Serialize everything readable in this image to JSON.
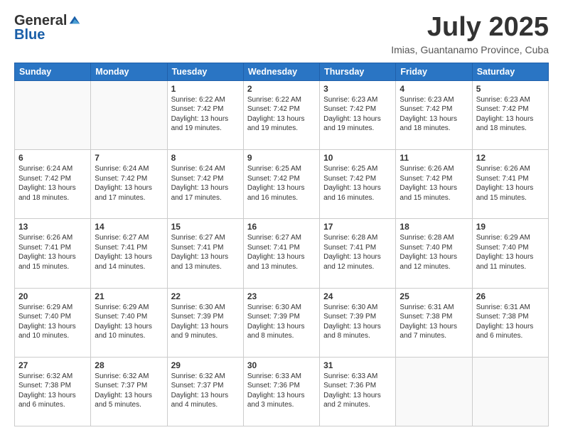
{
  "logo": {
    "general": "General",
    "blue": "Blue"
  },
  "header": {
    "month": "July 2025",
    "location": "Imias, Guantanamo Province, Cuba"
  },
  "days": [
    "Sunday",
    "Monday",
    "Tuesday",
    "Wednesday",
    "Thursday",
    "Friday",
    "Saturday"
  ],
  "weeks": [
    [
      {
        "day": "",
        "info": ""
      },
      {
        "day": "",
        "info": ""
      },
      {
        "day": "1",
        "info": "Sunrise: 6:22 AM\nSunset: 7:42 PM\nDaylight: 13 hours\nand 19 minutes."
      },
      {
        "day": "2",
        "info": "Sunrise: 6:22 AM\nSunset: 7:42 PM\nDaylight: 13 hours\nand 19 minutes."
      },
      {
        "day": "3",
        "info": "Sunrise: 6:23 AM\nSunset: 7:42 PM\nDaylight: 13 hours\nand 19 minutes."
      },
      {
        "day": "4",
        "info": "Sunrise: 6:23 AM\nSunset: 7:42 PM\nDaylight: 13 hours\nand 18 minutes."
      },
      {
        "day": "5",
        "info": "Sunrise: 6:23 AM\nSunset: 7:42 PM\nDaylight: 13 hours\nand 18 minutes."
      }
    ],
    [
      {
        "day": "6",
        "info": "Sunrise: 6:24 AM\nSunset: 7:42 PM\nDaylight: 13 hours\nand 18 minutes."
      },
      {
        "day": "7",
        "info": "Sunrise: 6:24 AM\nSunset: 7:42 PM\nDaylight: 13 hours\nand 17 minutes."
      },
      {
        "day": "8",
        "info": "Sunrise: 6:24 AM\nSunset: 7:42 PM\nDaylight: 13 hours\nand 17 minutes."
      },
      {
        "day": "9",
        "info": "Sunrise: 6:25 AM\nSunset: 7:42 PM\nDaylight: 13 hours\nand 16 minutes."
      },
      {
        "day": "10",
        "info": "Sunrise: 6:25 AM\nSunset: 7:42 PM\nDaylight: 13 hours\nand 16 minutes."
      },
      {
        "day": "11",
        "info": "Sunrise: 6:26 AM\nSunset: 7:42 PM\nDaylight: 13 hours\nand 15 minutes."
      },
      {
        "day": "12",
        "info": "Sunrise: 6:26 AM\nSunset: 7:41 PM\nDaylight: 13 hours\nand 15 minutes."
      }
    ],
    [
      {
        "day": "13",
        "info": "Sunrise: 6:26 AM\nSunset: 7:41 PM\nDaylight: 13 hours\nand 15 minutes."
      },
      {
        "day": "14",
        "info": "Sunrise: 6:27 AM\nSunset: 7:41 PM\nDaylight: 13 hours\nand 14 minutes."
      },
      {
        "day": "15",
        "info": "Sunrise: 6:27 AM\nSunset: 7:41 PM\nDaylight: 13 hours\nand 13 minutes."
      },
      {
        "day": "16",
        "info": "Sunrise: 6:27 AM\nSunset: 7:41 PM\nDaylight: 13 hours\nand 13 minutes."
      },
      {
        "day": "17",
        "info": "Sunrise: 6:28 AM\nSunset: 7:41 PM\nDaylight: 13 hours\nand 12 minutes."
      },
      {
        "day": "18",
        "info": "Sunrise: 6:28 AM\nSunset: 7:40 PM\nDaylight: 13 hours\nand 12 minutes."
      },
      {
        "day": "19",
        "info": "Sunrise: 6:29 AM\nSunset: 7:40 PM\nDaylight: 13 hours\nand 11 minutes."
      }
    ],
    [
      {
        "day": "20",
        "info": "Sunrise: 6:29 AM\nSunset: 7:40 PM\nDaylight: 13 hours\nand 10 minutes."
      },
      {
        "day": "21",
        "info": "Sunrise: 6:29 AM\nSunset: 7:40 PM\nDaylight: 13 hours\nand 10 minutes."
      },
      {
        "day": "22",
        "info": "Sunrise: 6:30 AM\nSunset: 7:39 PM\nDaylight: 13 hours\nand 9 minutes."
      },
      {
        "day": "23",
        "info": "Sunrise: 6:30 AM\nSunset: 7:39 PM\nDaylight: 13 hours\nand 8 minutes."
      },
      {
        "day": "24",
        "info": "Sunrise: 6:30 AM\nSunset: 7:39 PM\nDaylight: 13 hours\nand 8 minutes."
      },
      {
        "day": "25",
        "info": "Sunrise: 6:31 AM\nSunset: 7:38 PM\nDaylight: 13 hours\nand 7 minutes."
      },
      {
        "day": "26",
        "info": "Sunrise: 6:31 AM\nSunset: 7:38 PM\nDaylight: 13 hours\nand 6 minutes."
      }
    ],
    [
      {
        "day": "27",
        "info": "Sunrise: 6:32 AM\nSunset: 7:38 PM\nDaylight: 13 hours\nand 6 minutes."
      },
      {
        "day": "28",
        "info": "Sunrise: 6:32 AM\nSunset: 7:37 PM\nDaylight: 13 hours\nand 5 minutes."
      },
      {
        "day": "29",
        "info": "Sunrise: 6:32 AM\nSunset: 7:37 PM\nDaylight: 13 hours\nand 4 minutes."
      },
      {
        "day": "30",
        "info": "Sunrise: 6:33 AM\nSunset: 7:36 PM\nDaylight: 13 hours\nand 3 minutes."
      },
      {
        "day": "31",
        "info": "Sunrise: 6:33 AM\nSunset: 7:36 PM\nDaylight: 13 hours\nand 2 minutes."
      },
      {
        "day": "",
        "info": ""
      },
      {
        "day": "",
        "info": ""
      }
    ]
  ]
}
